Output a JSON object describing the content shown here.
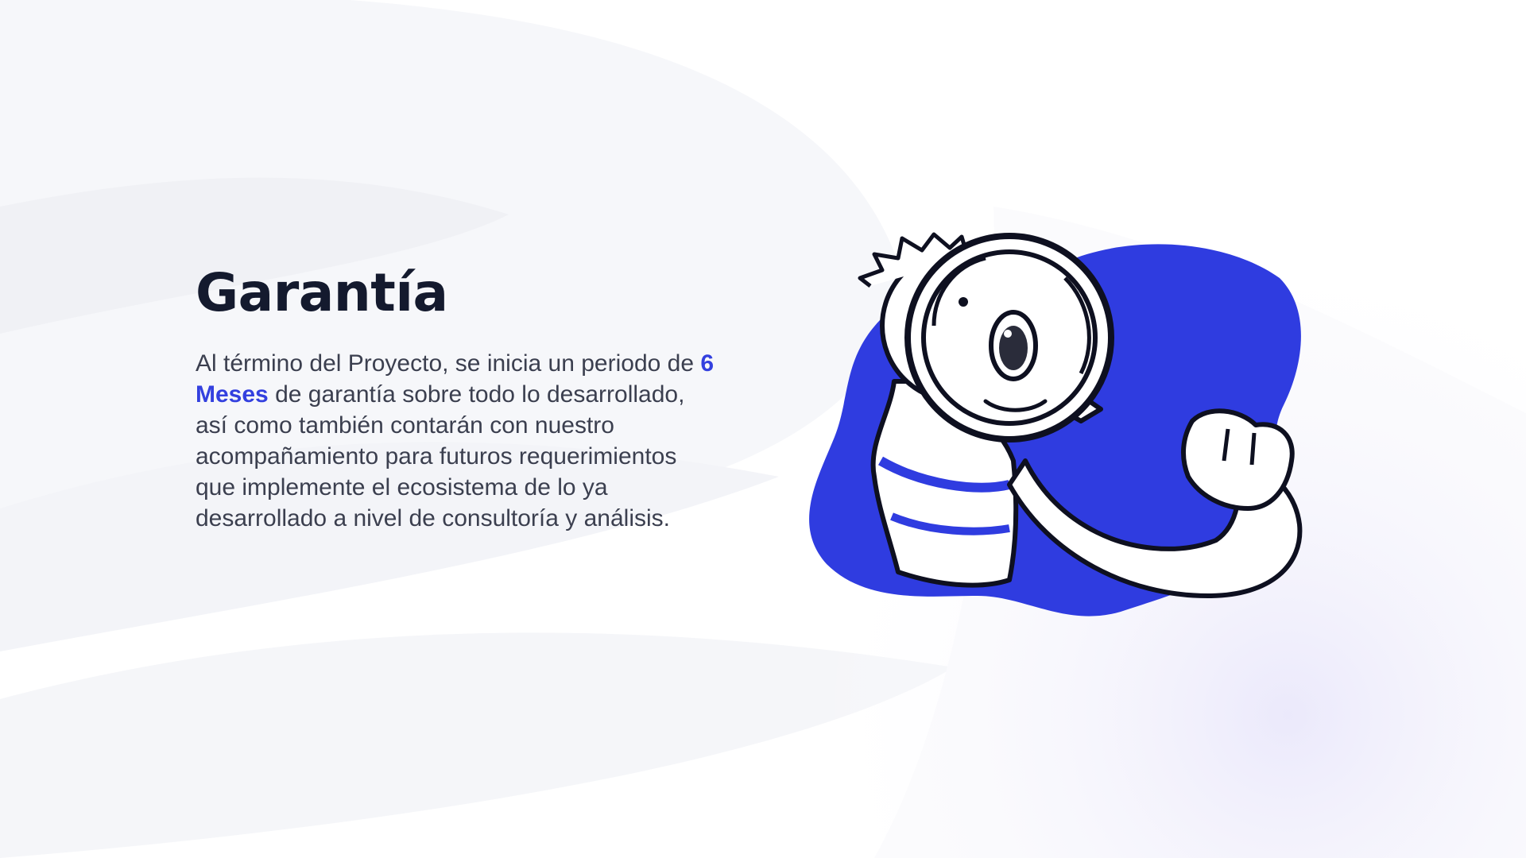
{
  "slide": {
    "title": "Garantía",
    "body": {
      "before": "Al término del Proyecto, se inicia un periodo de ",
      "highlight": "6 Meses",
      "after": " de garantía sobre todo lo desarrollado, así como también contarán con nuestro acompañamiento para futuros requerimientos que implemente el ecosistema de lo ya desarrollado a nivel de consultoría y análisis."
    },
    "illustration": {
      "icon": "person-with-magnifying-glass-icon"
    }
  },
  "colors": {
    "accent": "#3340df",
    "title": "#141a2e",
    "body": "#3b3f4f",
    "background": "#ffffff"
  }
}
